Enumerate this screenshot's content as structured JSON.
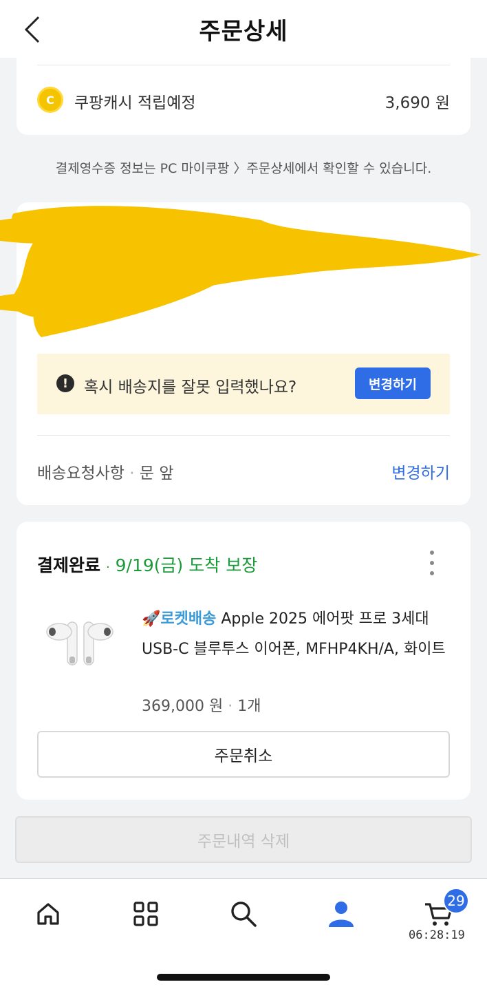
{
  "header": {
    "title": "주문상세"
  },
  "cash": {
    "label": "쿠팡캐시 적립예정",
    "amount": "3,690 원",
    "coin_glyph": "C"
  },
  "receipt_note": "결제영수증 정보는 PC 마이쿠팡 〉주문상세에서 확인할 수 있습니다.",
  "address": {
    "warning_text": "혹시 배송지를 잘못 입력했나요?",
    "change_button": "변경하기",
    "request_label": "배송요청사항",
    "request_sep": "·",
    "request_value": "문 앞",
    "request_change": "변경하기"
  },
  "order": {
    "status": "결제완료",
    "status_sep": "·",
    "arrival": "9/19(금) 도착 보장",
    "rocket_label": "🚀로켓배송",
    "product_name": "Apple 2025 에어팟 프로 3세대 USB-C 블루투스 이어폰, MFHP4KH/A, 화이트",
    "price": "369,000 원",
    "qty_sep": "·",
    "qty": "1개",
    "cancel_button": "주문취소"
  },
  "delete_button": "주문내역 삭제",
  "tabbar": {
    "cart_badge": "29",
    "clock": "06:28:19",
    "active_color": "#2f6de6"
  }
}
